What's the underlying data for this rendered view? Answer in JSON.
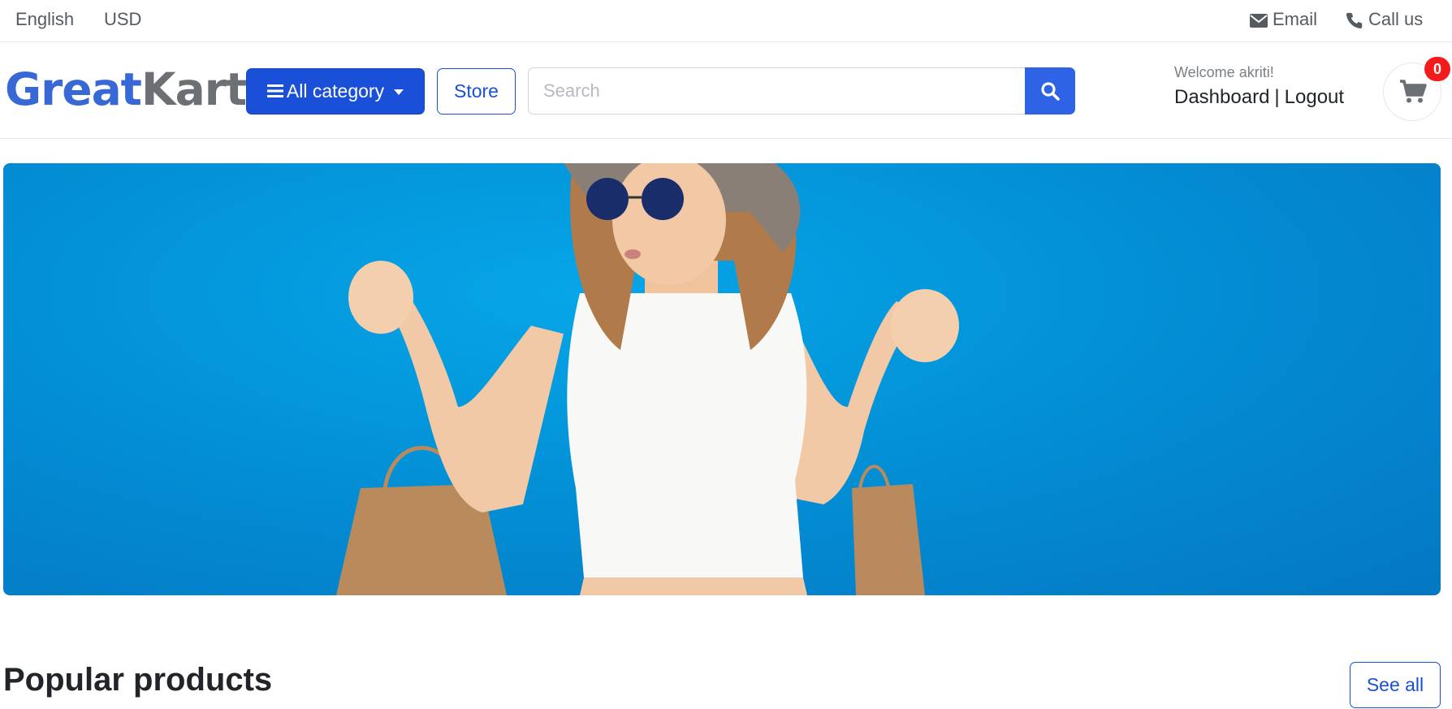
{
  "topbar": {
    "language": "English",
    "currency": "USD",
    "email_label": "Email",
    "call_label": "Call us"
  },
  "header": {
    "logo_part1": "Great",
    "logo_part2": "Kart",
    "category_label": "All category",
    "store_label": "Store",
    "search_placeholder": "Search",
    "welcome_text": "Welcome akriti!",
    "dashboard_label": "Dashboard",
    "separator": "|",
    "logout_label": "Logout",
    "cart_count": "0"
  },
  "section": {
    "title": "Popular products",
    "see_all_label": "See all"
  },
  "colors": {
    "primary": "#1a4fd8",
    "logo_blue": "#3867d6",
    "logo_gray": "#6c6f73",
    "badge_red": "#f31c1c",
    "banner_blue": "#0390d6"
  },
  "icons": [
    "envelope-icon",
    "phone-icon",
    "bars-icon",
    "caret-down-icon",
    "search-icon",
    "cart-icon"
  ]
}
